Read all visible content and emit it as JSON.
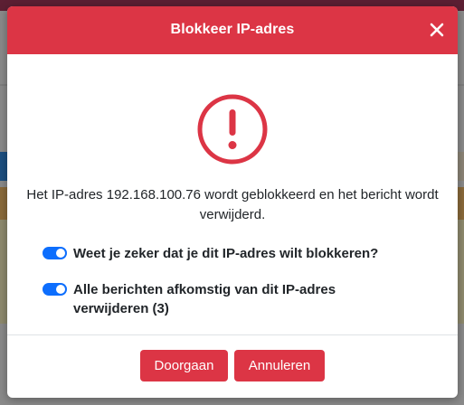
{
  "dialog": {
    "title": "Blokkeer IP-adres",
    "message": "Het IP-adres 192.168.100.76 wordt geblokkeerd en het bericht wordt verwijderd.",
    "options": [
      {
        "label": "Weet je zeker dat je dit IP-adres wilt blokkeren?",
        "checked": true
      },
      {
        "label": "Alle berichten afkomstig van dit IP-adres verwijderen (3)",
        "checked": true
      }
    ],
    "buttons": {
      "continue_label": "Doorgaan",
      "cancel_label": "Annuleren"
    },
    "icons": {
      "close": "close-icon",
      "warning": "exclamation-circle-icon"
    },
    "colors": {
      "header": "#dc3545",
      "toggle": "#0d6efd",
      "button": "#dc3545"
    }
  }
}
